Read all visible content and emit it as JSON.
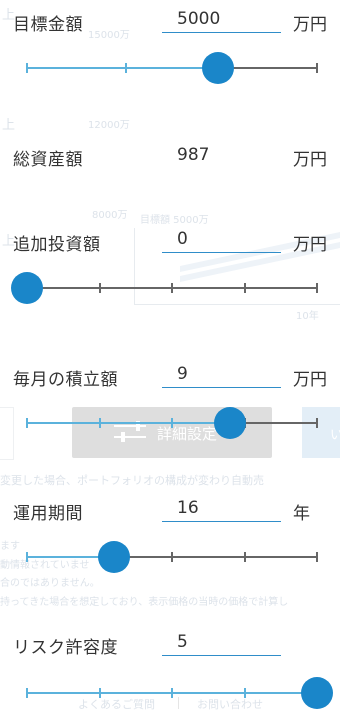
{
  "background": {
    "chart_labels": [
      "上",
      "15000万",
      "上",
      "12000万",
      "8000万",
      "目標額 5000万",
      "上",
      "10年"
    ],
    "settings_button_label": "詳細設定",
    "notice_line_1": "変更した場合、ポートフォリオの構成が変わり自動売",
    "disclaimer_lines": [
      "ます",
      "動情報されていませ",
      "合のではありません。",
      "持ってきた場合を想定しており、表示価格の当時の価格で計算し"
    ],
    "footer_links": [
      "よくあるご質問",
      "お問い合わせ"
    ]
  },
  "rows": {
    "target": {
      "label": "目標金額",
      "value": "5000",
      "unit": "万円"
    },
    "assets": {
      "label": "総資産額",
      "value": "987",
      "unit": "万円"
    },
    "additional": {
      "label": "追加投資額",
      "value": "0",
      "unit": "万円"
    },
    "monthly": {
      "label": "毎月の積立額",
      "value": "9",
      "unit": "万円"
    },
    "period": {
      "label": "運用期間",
      "value": "16",
      "unit": "年"
    },
    "risk": {
      "label": "リスク許容度",
      "value": "5"
    }
  },
  "sliders": {
    "target": {
      "level": 0.66,
      "ticks": [
        0.34,
        1
      ]
    },
    "additional": {
      "level": 0,
      "ticks": [
        0.25,
        0.5,
        0.75,
        1
      ]
    },
    "monthly": {
      "level": 0.7,
      "ticks": [
        0.25,
        0.5,
        0.75,
        1
      ]
    },
    "period": {
      "level": 0.3,
      "ticks": [
        0.25,
        0.5,
        0.75,
        1
      ]
    },
    "risk": {
      "level": 1,
      "ticks": [
        0.25,
        0.5,
        0.75,
        1
      ]
    }
  },
  "colors": {
    "accent": "#1a86c9",
    "fill": "#5bb2dc",
    "track": "#666666",
    "underline": "#2f8dc9"
  }
}
